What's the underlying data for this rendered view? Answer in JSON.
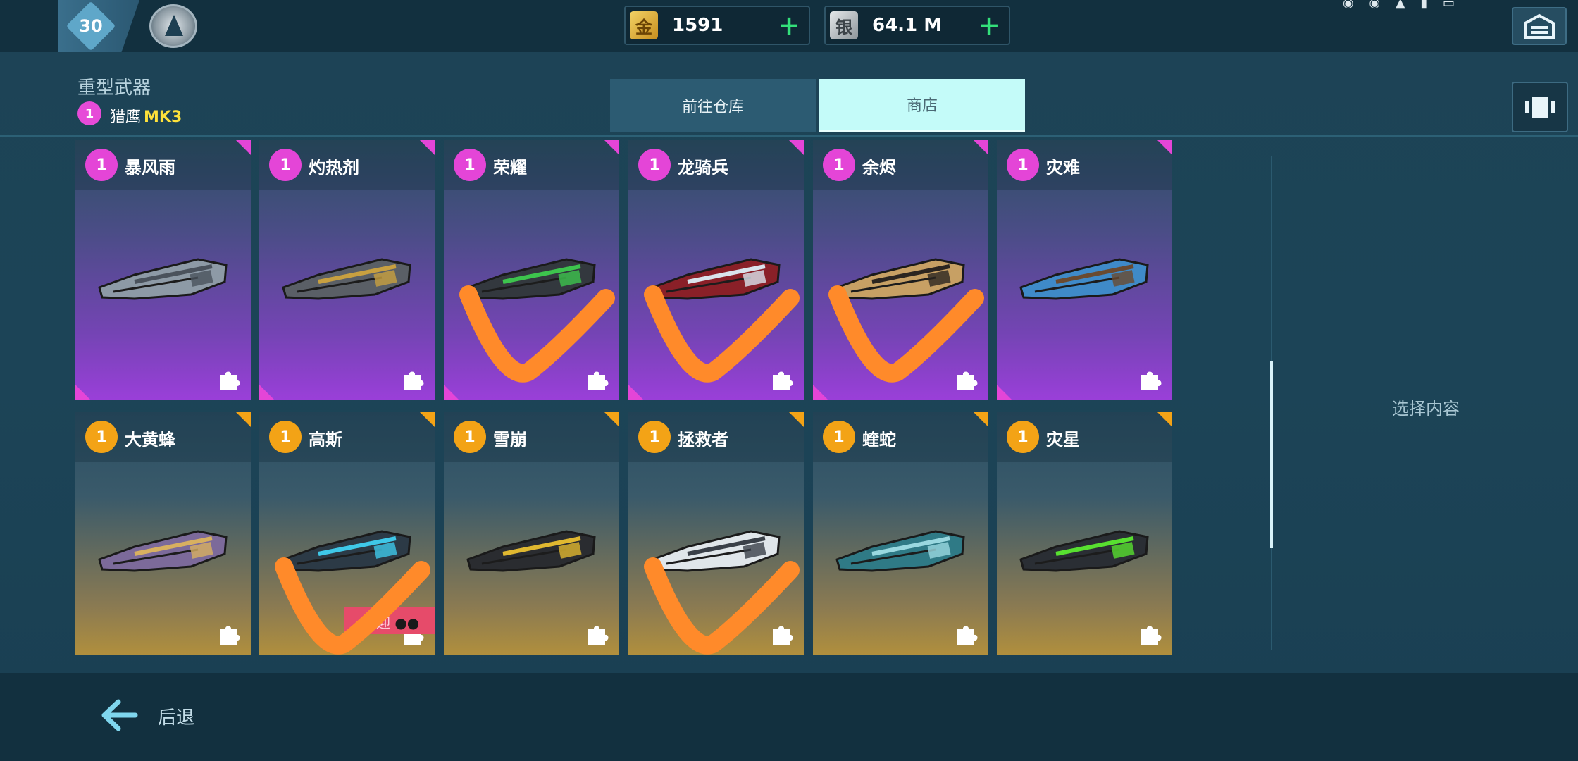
{
  "player": {
    "level": "30"
  },
  "currency": {
    "gold": {
      "icon": "金",
      "value": "1591"
    },
    "silver": {
      "icon": "银",
      "value": "64.1 M"
    },
    "plus_label": "+"
  },
  "header": {
    "category": "重型武器",
    "selected": {
      "rank": "1",
      "name": "猎鹰",
      "mk": "MK3"
    }
  },
  "tabs": [
    {
      "label": "前往仓库",
      "active": false
    },
    {
      "label": "商店",
      "active": true
    }
  ],
  "weapons_row1": [
    {
      "rank": "1",
      "name": "暴风雨",
      "rarity": "purple",
      "checked": false
    },
    {
      "rank": "1",
      "name": "灼热剂",
      "rarity": "purple",
      "checked": false
    },
    {
      "rank": "1",
      "name": "荣耀",
      "rarity": "purple",
      "checked": true
    },
    {
      "rank": "1",
      "name": "龙骑兵",
      "rarity": "purple",
      "checked": true
    },
    {
      "rank": "1",
      "name": "余烬",
      "rarity": "purple",
      "checked": true
    },
    {
      "rank": "1",
      "name": "灾难",
      "rarity": "purple",
      "checked": false
    }
  ],
  "weapons_row2": [
    {
      "rank": "1",
      "name": "大黄蜂",
      "rarity": "orange",
      "checked": false
    },
    {
      "rank": "1",
      "name": "高斯",
      "rarity": "orange",
      "checked": true
    },
    {
      "rank": "1",
      "name": "雪崩",
      "rarity": "orange",
      "checked": false
    },
    {
      "rank": "1",
      "name": "拯救者",
      "rarity": "orange",
      "checked": true
    },
    {
      "rank": "1",
      "name": "蝰蛇",
      "rarity": "orange",
      "checked": false
    },
    {
      "rank": "1",
      "name": "灾星",
      "rarity": "orange",
      "checked": false
    }
  ],
  "collab_tag": {
    "label": "迎"
  },
  "side_panel": {
    "placeholder": "选择内容"
  },
  "footer": {
    "back_label": "后退"
  },
  "colors": {
    "purple_rarity": "#e445d7",
    "orange_rarity": "#f3a316",
    "check_mark": "#ff8a2a",
    "accent_green": "#33e07a"
  }
}
